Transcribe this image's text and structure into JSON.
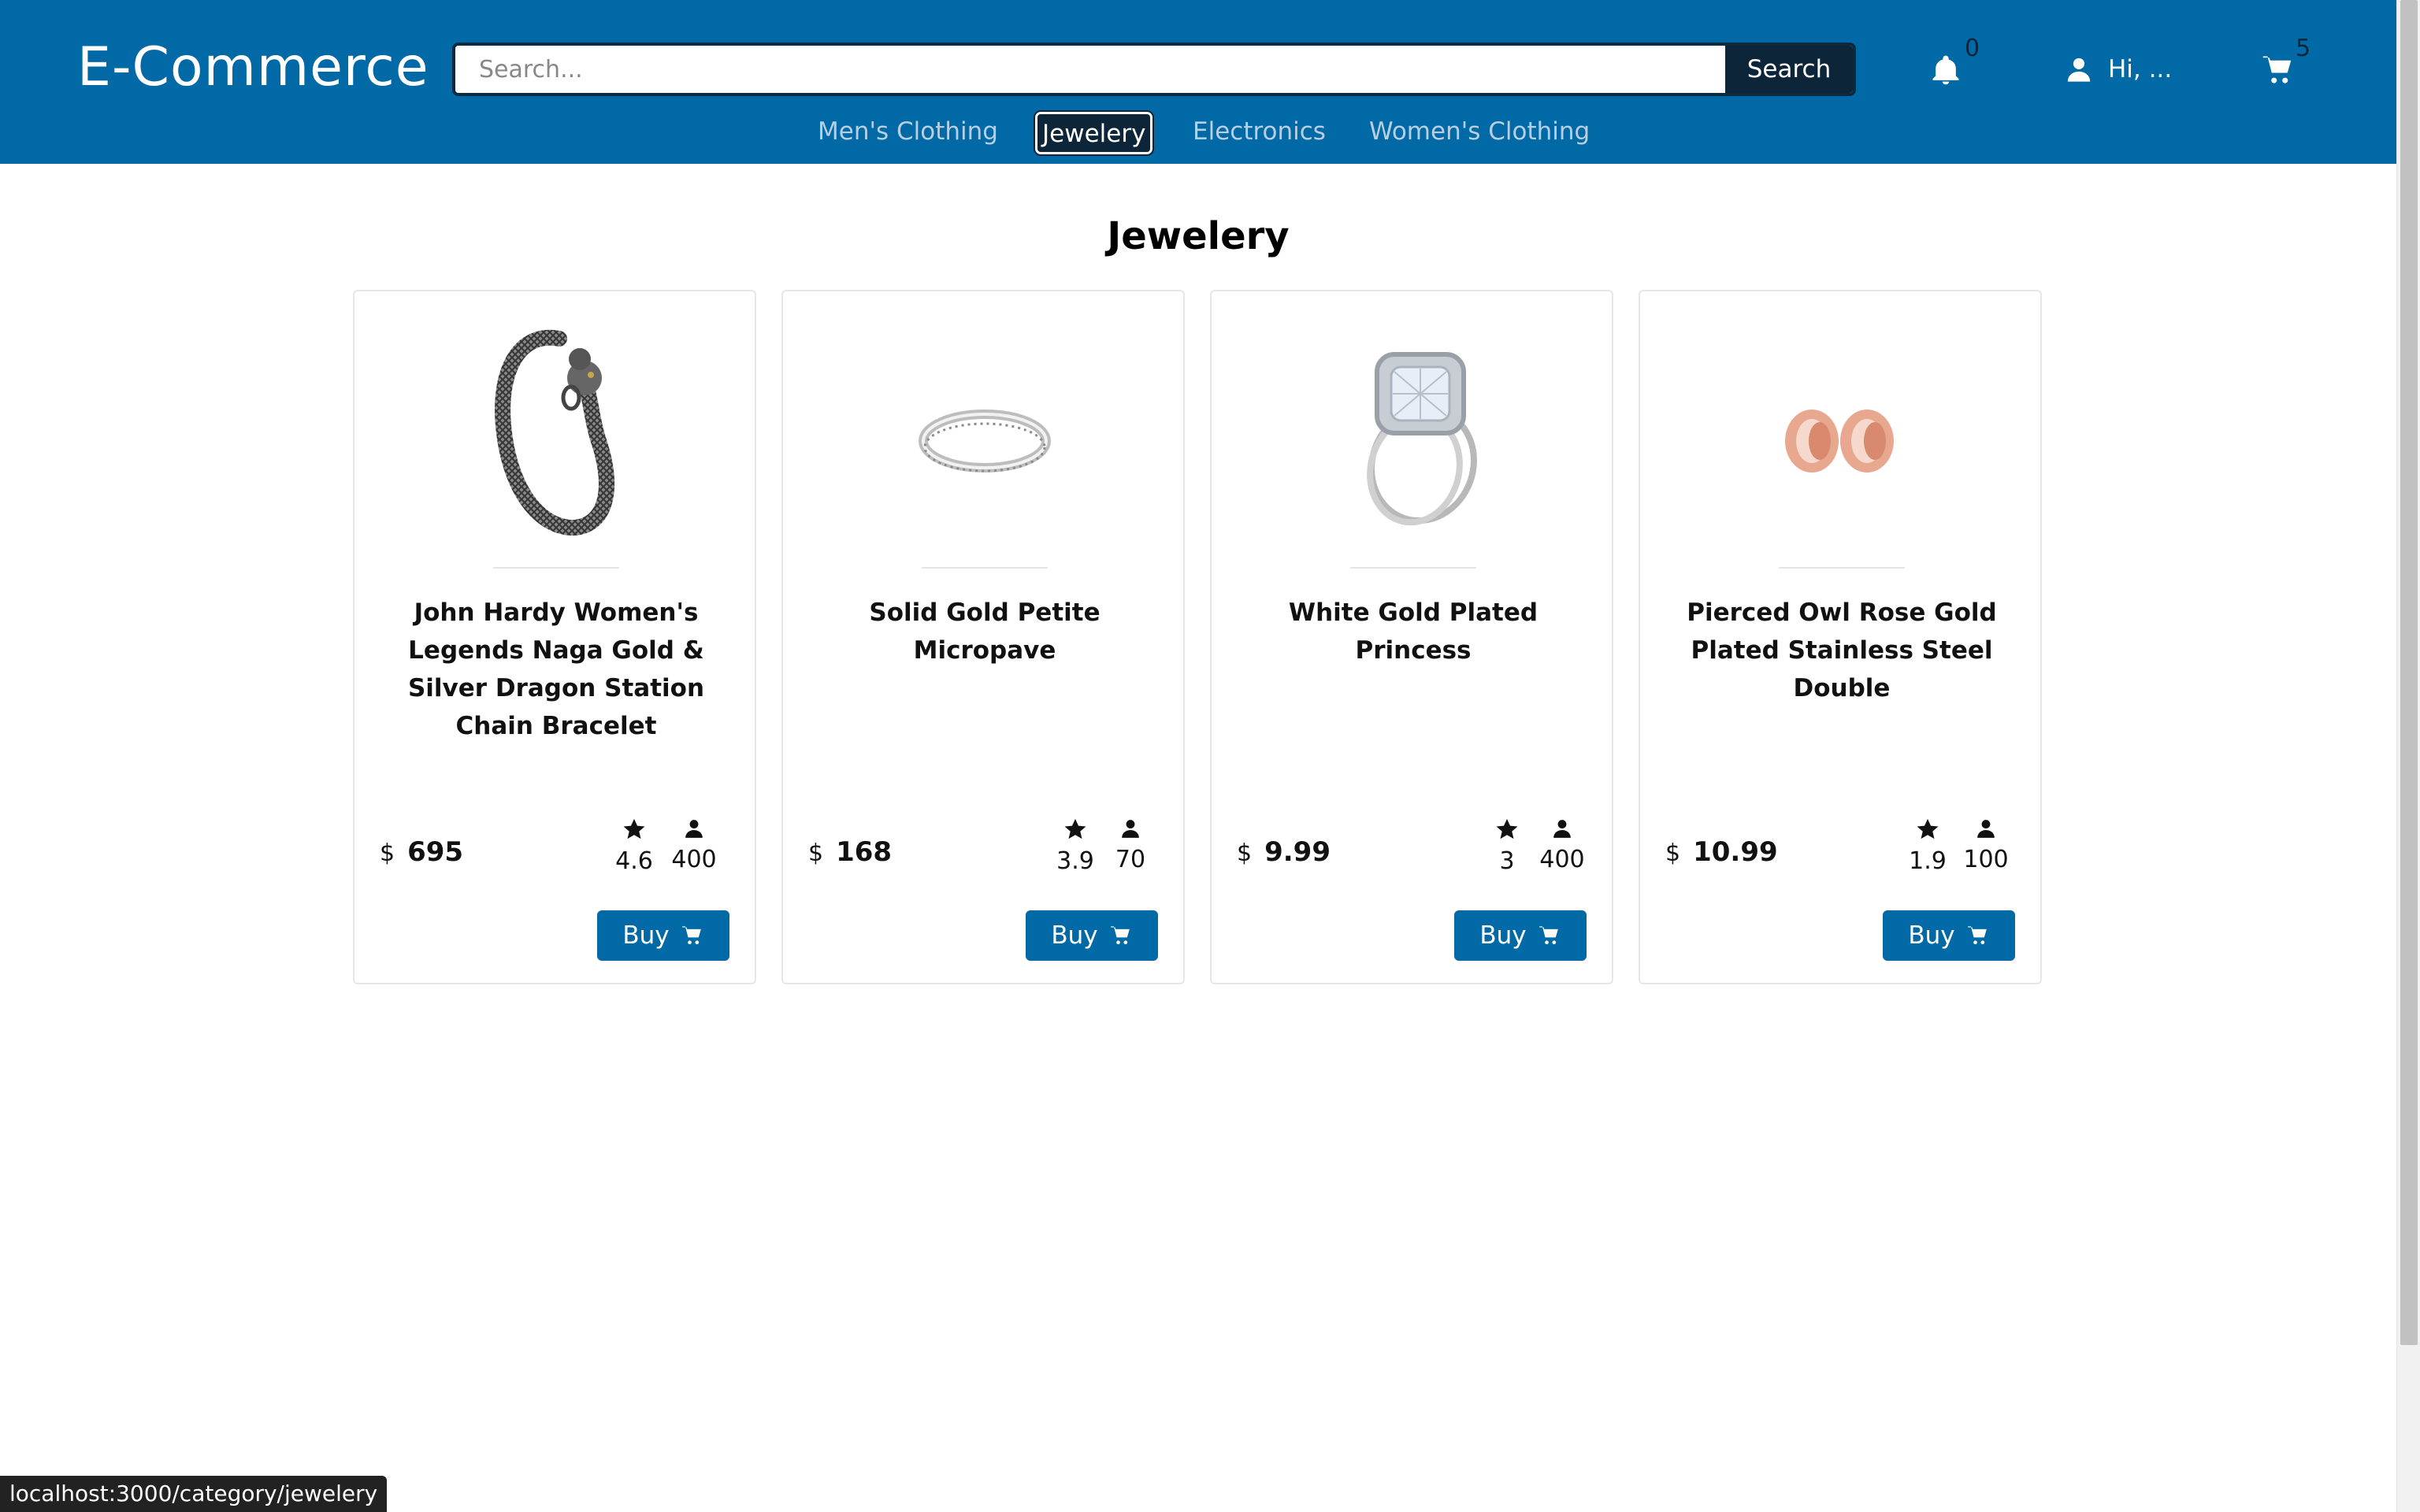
{
  "header": {
    "logo": "E-Commerce",
    "search": {
      "placeholder": "Search...",
      "value": "",
      "button_label": "Search"
    },
    "notifications_count": "0",
    "user_label": "Hi, ...",
    "cart_count": "5"
  },
  "nav": {
    "items": [
      {
        "label": "Men's Clothing"
      },
      {
        "label": "Jewelery",
        "active": true
      },
      {
        "label": "Electronics"
      },
      {
        "label": "Women's Clothing"
      }
    ]
  },
  "page": {
    "title": "Jewelery"
  },
  "products": [
    {
      "title": "John Hardy Women's Legends Naga Gold & Silver Dragon Station Chain Bracelet",
      "currency": "$",
      "price": "695",
      "rating": "4.6",
      "count": "400",
      "buy_label": "Buy",
      "image": "bracelet"
    },
    {
      "title": "Solid Gold Petite Micropave",
      "currency": "$",
      "price": "168",
      "rating": "3.9",
      "count": "70",
      "buy_label": "Buy",
      "image": "ring"
    },
    {
      "title": "White Gold Plated Princess",
      "currency": "$",
      "price": "9.99",
      "rating": "3",
      "count": "400",
      "buy_label": "Buy",
      "image": "diamond-ring"
    },
    {
      "title": "Pierced Owl Rose Gold Plated Stainless Steel Double",
      "currency": "$",
      "price": "10.99",
      "rating": "1.9",
      "count": "100",
      "buy_label": "Buy",
      "image": "rose-gold-plugs"
    }
  ],
  "statusbar": {
    "url": "localhost:3000/category/jewelery"
  },
  "colors": {
    "primary": "#0069a6",
    "dark": "#0c2538",
    "nav_inactive": "#b7cfe2"
  }
}
